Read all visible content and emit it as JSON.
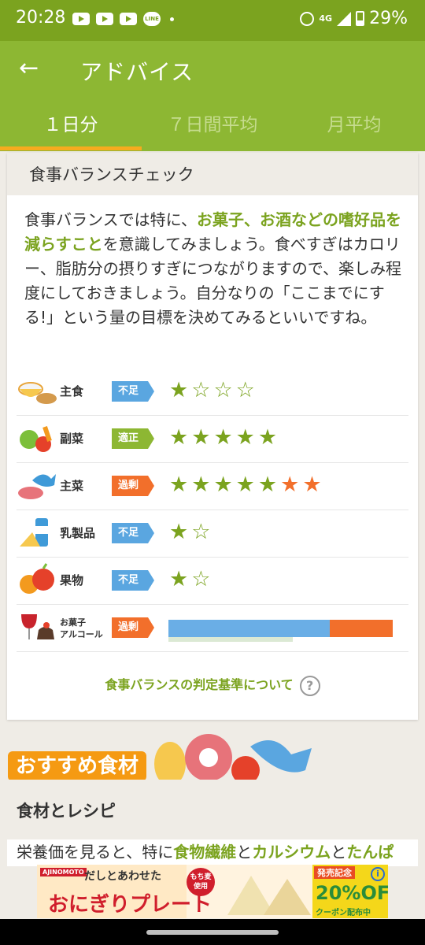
{
  "status": {
    "time": "20:28",
    "network": "4G",
    "battery": "29%"
  },
  "header": {
    "title": "アドバイス"
  },
  "tabs": [
    {
      "label": "１日分"
    },
    {
      "label": "７日間平均"
    },
    {
      "label": "月平均"
    }
  ],
  "balance": {
    "heading": "食事バランスチェック",
    "advice": {
      "p1": "食事バランスでは特に、",
      "h1": "お菓子、お酒などの嗜好品を減らすこと",
      "p2": "を意識してみましょう。食べすぎはカロリー、脂肪分の摂りすぎにつながりますので、楽しみ程度にしておきましょう。自分なりの「ここまでにする!」という量の目標を決めてみるといいですね。"
    },
    "rows": [
      {
        "name": "主食",
        "status": "不足",
        "status_color": "#5aa6e0",
        "rating": 1,
        "max": 4,
        "orange": 0
      },
      {
        "name": "副菜",
        "status": "適正",
        "status_color": "#8db733",
        "rating": 5,
        "max": 5,
        "orange": 0
      },
      {
        "name": "主菜",
        "status": "過剰",
        "status_color": "#f26f2b",
        "rating": 7,
        "max": 7,
        "orange": 2
      },
      {
        "name": "乳製品",
        "status": "不足",
        "status_color": "#5aa6e0",
        "rating": 1,
        "max": 2,
        "orange": 0
      },
      {
        "name": "果物",
        "status": "不足",
        "status_color": "#5aa6e0",
        "rating": 1,
        "max": 2,
        "orange": 0
      },
      {
        "name_line1": "お菓子",
        "name_line2": "アルコール",
        "status": "過剰",
        "status_color": "#f26f2b",
        "bar_normal": 0.72,
        "bar_excess": 0.28
      }
    ],
    "criteria_link": "食事バランスの判定基準について",
    "help_glyph": "?"
  },
  "recommend": {
    "banner": "おすすめ食材",
    "card_title": "食材とレシピ",
    "text": {
      "a": "栄養価を見ると、特に",
      "b": "食物繊維",
      "c": "と",
      "d": "カルシウム",
      "e": "と",
      "f": "たんぱ"
    }
  },
  "ad": {
    "brand": "AJINOMOTO",
    "sub": "だしとあわせた",
    "main": "おにぎりプレート",
    "tag": "もち麦 使用",
    "label": "発売記念",
    "big": "20%OFF",
    "small": "クーポン配布中",
    "info": "i"
  }
}
